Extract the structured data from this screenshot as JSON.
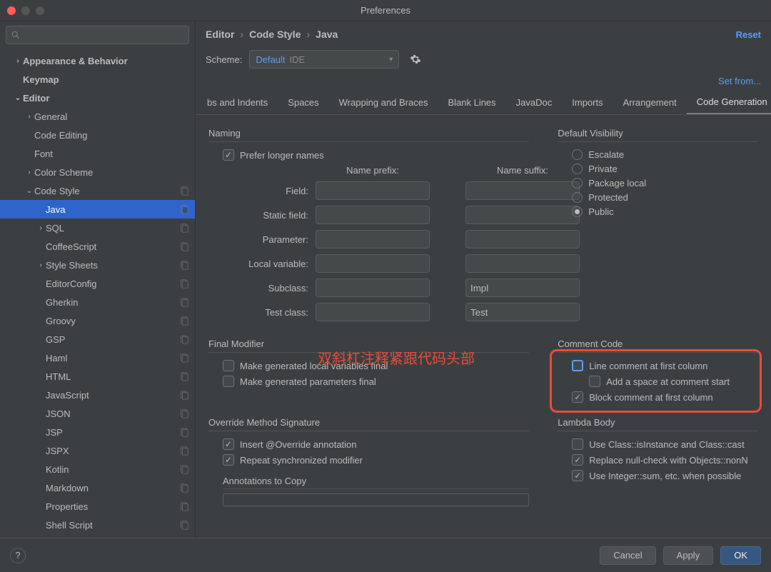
{
  "window": {
    "title": "Preferences"
  },
  "search": {
    "placeholder": ""
  },
  "sidebar": [
    {
      "label": "Appearance & Behavior",
      "depth": 1,
      "chev": "›",
      "bold": true,
      "badge": false
    },
    {
      "label": "Keymap",
      "depth": 1,
      "chev": "",
      "bold": true,
      "badge": false
    },
    {
      "label": "Editor",
      "depth": 1,
      "chev": "⌄",
      "bold": true,
      "badge": false
    },
    {
      "label": "General",
      "depth": 2,
      "chev": "›",
      "bold": false,
      "badge": false
    },
    {
      "label": "Code Editing",
      "depth": 2,
      "chev": "",
      "bold": false,
      "badge": false
    },
    {
      "label": "Font",
      "depth": 2,
      "chev": "",
      "bold": false,
      "badge": false
    },
    {
      "label": "Color Scheme",
      "depth": 2,
      "chev": "›",
      "bold": false,
      "badge": false
    },
    {
      "label": "Code Style",
      "depth": 2,
      "chev": "⌄",
      "bold": false,
      "badge": true
    },
    {
      "label": "Java",
      "depth": 3,
      "chev": "",
      "bold": false,
      "badge": true,
      "selected": true
    },
    {
      "label": "SQL",
      "depth": 3,
      "chev": "›",
      "bold": false,
      "badge": true
    },
    {
      "label": "CoffeeScript",
      "depth": 3,
      "chev": "",
      "bold": false,
      "badge": true
    },
    {
      "label": "Style Sheets",
      "depth": 3,
      "chev": "›",
      "bold": false,
      "badge": true
    },
    {
      "label": "EditorConfig",
      "depth": 3,
      "chev": "",
      "bold": false,
      "badge": true
    },
    {
      "label": "Gherkin",
      "depth": 3,
      "chev": "",
      "bold": false,
      "badge": true
    },
    {
      "label": "Groovy",
      "depth": 3,
      "chev": "",
      "bold": false,
      "badge": true
    },
    {
      "label": "GSP",
      "depth": 3,
      "chev": "",
      "bold": false,
      "badge": true
    },
    {
      "label": "Haml",
      "depth": 3,
      "chev": "",
      "bold": false,
      "badge": true
    },
    {
      "label": "HTML",
      "depth": 3,
      "chev": "",
      "bold": false,
      "badge": true
    },
    {
      "label": "JavaScript",
      "depth": 3,
      "chev": "",
      "bold": false,
      "badge": true
    },
    {
      "label": "JSON",
      "depth": 3,
      "chev": "",
      "bold": false,
      "badge": true
    },
    {
      "label": "JSP",
      "depth": 3,
      "chev": "",
      "bold": false,
      "badge": true
    },
    {
      "label": "JSPX",
      "depth": 3,
      "chev": "",
      "bold": false,
      "badge": true
    },
    {
      "label": "Kotlin",
      "depth": 3,
      "chev": "",
      "bold": false,
      "badge": true
    },
    {
      "label": "Markdown",
      "depth": 3,
      "chev": "",
      "bold": false,
      "badge": true
    },
    {
      "label": "Properties",
      "depth": 3,
      "chev": "",
      "bold": false,
      "badge": true
    },
    {
      "label": "Shell Script",
      "depth": 3,
      "chev": "",
      "bold": false,
      "badge": true
    }
  ],
  "breadcrumbs": [
    "Editor",
    "Code Style",
    "Java"
  ],
  "reset_label": "Reset",
  "scheme": {
    "label": "Scheme:",
    "value": "Default",
    "scope": "IDE"
  },
  "set_from": "Set from...",
  "tabs": [
    "bs and Indents",
    "Spaces",
    "Wrapping and Braces",
    "Blank Lines",
    "JavaDoc",
    "Imports",
    "Arrangement",
    "Code Generation"
  ],
  "active_tab": 7,
  "naming": {
    "title": "Naming",
    "prefer_longer": "Prefer longer names",
    "prefix_hdr": "Name prefix:",
    "suffix_hdr": "Name suffix:",
    "rows": [
      {
        "label": "Field:",
        "prefix": "",
        "suffix": ""
      },
      {
        "label": "Static field:",
        "prefix": "",
        "suffix": ""
      },
      {
        "label": "Parameter:",
        "prefix": "",
        "suffix": ""
      },
      {
        "label": "Local variable:",
        "prefix": "",
        "suffix": ""
      },
      {
        "label": "Subclass:",
        "prefix": "",
        "suffix": "Impl"
      },
      {
        "label": "Test class:",
        "prefix": "",
        "suffix": "Test"
      }
    ]
  },
  "visibility": {
    "title": "Default Visibility",
    "options": [
      "Escalate",
      "Private",
      "Package local",
      "Protected",
      "Public"
    ],
    "selected": 4
  },
  "final_mod": {
    "title": "Final Modifier",
    "local_vars": "Make generated local variables final",
    "params": "Make generated parameters final"
  },
  "comment": {
    "title": "Comment Code",
    "line_first": "Line comment at first column",
    "add_space": "Add a space at comment start",
    "block_first": "Block comment at first column"
  },
  "override": {
    "title": "Override Method Signature",
    "insert": "Insert @Override annotation",
    "repeat": "Repeat synchronized modifier",
    "annot": "Annotations to Copy"
  },
  "lambda": {
    "title": "Lambda Body",
    "isinstance": "Use Class::isInstance and Class::cast",
    "nullcheck": "Replace null-check with Objects::nonN",
    "integersum": "Use Integer::sum, etc. when possible"
  },
  "annotation_chinese": "双斜杠注释紧跟代码头部",
  "buttons": {
    "cancel": "Cancel",
    "apply": "Apply",
    "ok": "OK"
  }
}
